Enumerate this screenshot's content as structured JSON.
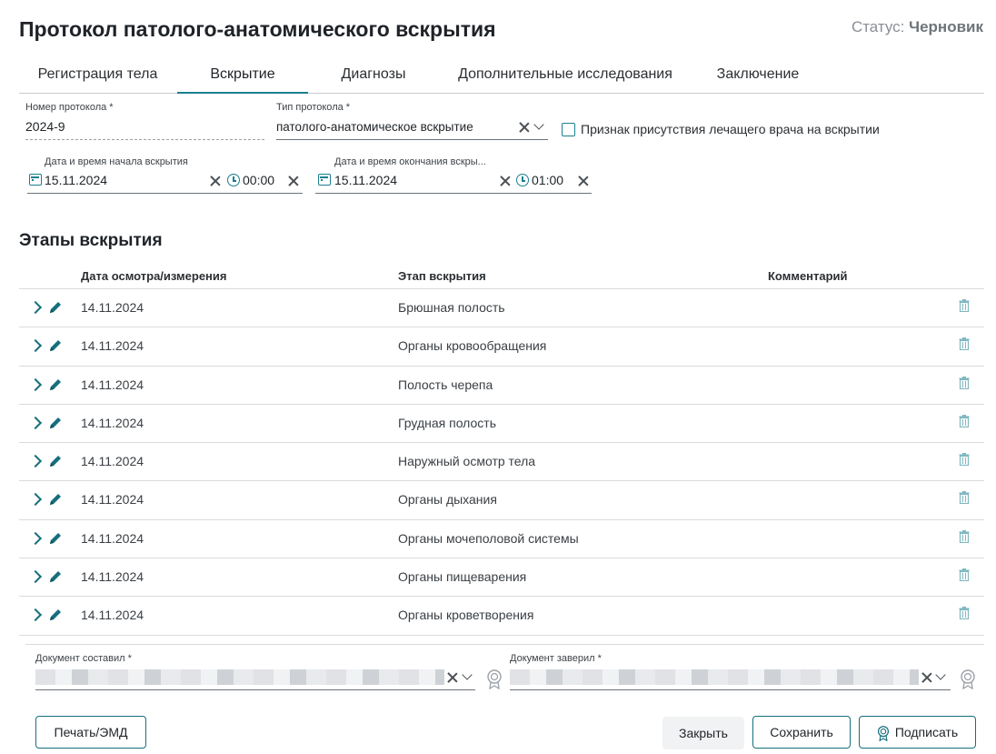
{
  "page": {
    "title": "Протокол патолого-анатомического вскрытия"
  },
  "status": {
    "label": "Статус:",
    "value": "Черновик"
  },
  "tabs": [
    {
      "label": "Регистрация тела"
    },
    {
      "label": "Вскрытие"
    },
    {
      "label": "Диагнозы"
    },
    {
      "label": "Дополнительные исследования"
    },
    {
      "label": "Заключение"
    }
  ],
  "form": {
    "protocol_number": {
      "label": "Номер протокола *",
      "value": "2024-9"
    },
    "protocol_type": {
      "label": "Тип протокола *",
      "value": "патолого-анатомическое вскрытие"
    },
    "doctor_present": {
      "label": "Признак присутствия лечащего врача на вскрытии",
      "checked": false
    },
    "start": {
      "label": "Дата и время начала вскрытия",
      "date": "15.11.2024",
      "time": "00:00"
    },
    "end": {
      "label": "Дата и время окончания вскры...",
      "date": "15.11.2024",
      "time": "01:00"
    }
  },
  "stages": {
    "title": "Этапы вскрытия",
    "columns": {
      "date": "Дата осмотра/измерения",
      "stage": "Этап вскрытия",
      "comment": "Комментарий"
    },
    "rows": [
      {
        "date": "14.11.2024",
        "stage": "Брюшная полость",
        "comment": ""
      },
      {
        "date": "14.11.2024",
        "stage": "Органы кровообращения",
        "comment": ""
      },
      {
        "date": "14.11.2024",
        "stage": "Полость черепа",
        "comment": ""
      },
      {
        "date": "14.11.2024",
        "stage": "Грудная полость",
        "comment": ""
      },
      {
        "date": "14.11.2024",
        "stage": "Наружный осмотр тела",
        "comment": ""
      },
      {
        "date": "14.11.2024",
        "stage": "Органы дыхания",
        "comment": ""
      },
      {
        "date": "14.11.2024",
        "stage": "Органы мочеполовой системы",
        "comment": ""
      },
      {
        "date": "14.11.2024",
        "stage": "Органы пищеварения",
        "comment": ""
      },
      {
        "date": "14.11.2024",
        "stage": "Органы кроветворения",
        "comment": ""
      }
    ]
  },
  "signers": {
    "composed": {
      "label": "Документ составил *"
    },
    "certified": {
      "label": "Документ заверил *"
    }
  },
  "footer": {
    "print_label": "Печать/ЭМД",
    "close_label": "Закрыть",
    "save_label": "Сохранить",
    "sign_label": "Подписать"
  },
  "colors": {
    "accent": "#1a7f8e",
    "text": "#212529",
    "muted": "#8a8f96"
  }
}
